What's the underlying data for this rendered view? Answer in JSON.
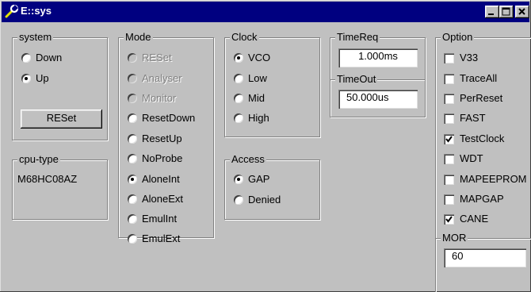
{
  "window": {
    "title": "E::sys",
    "icon": "wrench-icon",
    "controls": [
      "minimize-icon",
      "maximize-icon",
      "close-icon"
    ]
  },
  "system": {
    "title": "system",
    "options": [
      {
        "label": "Down",
        "selected": false
      },
      {
        "label": "Up",
        "selected": true
      }
    ],
    "reset_button": "RESet"
  },
  "cpu_type": {
    "title": "cpu-type",
    "value": "M68HC08AZ"
  },
  "mode": {
    "title": "Mode",
    "options": [
      {
        "label": "RESet",
        "selected": false,
        "disabled": true
      },
      {
        "label": "Analyser",
        "selected": false,
        "disabled": true
      },
      {
        "label": "Monitor",
        "selected": false,
        "disabled": true
      },
      {
        "label": "ResetDown",
        "selected": false,
        "disabled": false
      },
      {
        "label": "ResetUp",
        "selected": false,
        "disabled": false
      },
      {
        "label": "NoProbe",
        "selected": false,
        "disabled": false
      },
      {
        "label": "AloneInt",
        "selected": true,
        "disabled": false
      },
      {
        "label": "AloneExt",
        "selected": false,
        "disabled": false
      },
      {
        "label": "EmulInt",
        "selected": false,
        "disabled": false
      },
      {
        "label": "EmulExt",
        "selected": false,
        "disabled": false
      }
    ]
  },
  "clock": {
    "title": "Clock",
    "options": [
      {
        "label": "VCO",
        "selected": true
      },
      {
        "label": "Low",
        "selected": false
      },
      {
        "label": "Mid",
        "selected": false
      },
      {
        "label": "High",
        "selected": false
      }
    ]
  },
  "access": {
    "title": "Access",
    "options": [
      {
        "label": "GAP",
        "selected": true
      },
      {
        "label": "Denied",
        "selected": false
      }
    ]
  },
  "time_req": {
    "title": "TimeReq",
    "value": "1.000ms"
  },
  "time_out": {
    "title": "TimeOut",
    "value": "50.000us"
  },
  "option": {
    "title": "Option",
    "items": [
      {
        "label": "V33",
        "checked": false
      },
      {
        "label": "TraceAll",
        "checked": false
      },
      {
        "label": "PerReset",
        "checked": false
      },
      {
        "label": "FAST",
        "checked": false
      },
      {
        "label": "TestClock",
        "checked": true
      },
      {
        "label": "WDT",
        "checked": false
      },
      {
        "label": "MAPEEPROM",
        "checked": false
      },
      {
        "label": "MAPGAP",
        "checked": false
      },
      {
        "label": "CANE",
        "checked": true
      }
    ]
  },
  "mor": {
    "title": "MOR",
    "value": "60"
  }
}
